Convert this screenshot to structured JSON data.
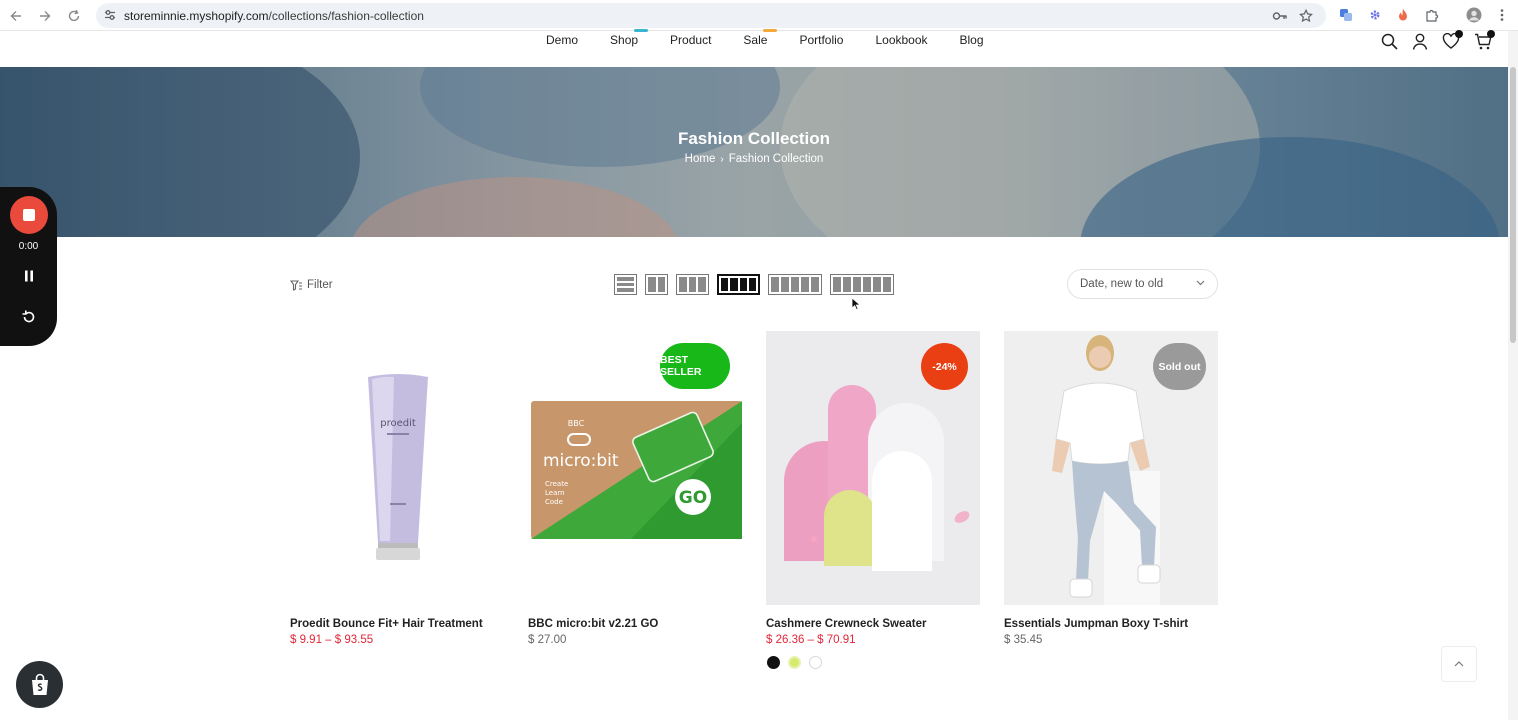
{
  "browser": {
    "url_host": "storeminnie.myshopify.com",
    "url_path": "/collections/fashion-collection"
  },
  "header": {
    "nav": [
      {
        "label": "Demo",
        "mark": ""
      },
      {
        "label": "Shop",
        "mark": "#39b6ce"
      },
      {
        "label": "Product",
        "mark": ""
      },
      {
        "label": "Sale",
        "mark": "#f3a93b"
      },
      {
        "label": "Portfolio",
        "mark": ""
      },
      {
        "label": "Lookbook",
        "mark": ""
      },
      {
        "label": "Blog",
        "mark": ""
      }
    ],
    "icons": [
      "search-icon",
      "account-icon",
      "wishlist-icon",
      "cart-icon"
    ]
  },
  "hero": {
    "title": "Fashion Collection",
    "breadcrumb": {
      "home": "Home",
      "separator": "›",
      "current": "Fashion Collection"
    }
  },
  "recorder": {
    "time": "0:00"
  },
  "toolbar": {
    "filter_label": "Filter",
    "layouts": [
      {
        "name": "list",
        "columns": 1,
        "active": false
      },
      {
        "name": "grid-2",
        "columns": 2,
        "active": false
      },
      {
        "name": "grid-3",
        "columns": 3,
        "active": false
      },
      {
        "name": "grid-4",
        "columns": 4,
        "active": true
      },
      {
        "name": "grid-5",
        "columns": 5,
        "active": false
      },
      {
        "name": "grid-6",
        "columns": 6,
        "active": false
      }
    ],
    "sort_value": "Date, new to old"
  },
  "products": [
    {
      "name": "Proedit Bounce Fit+ Hair Treatment",
      "price": "$ 9.91 – $ 93.55",
      "price_type": "sale",
      "badge": "",
      "badge_color": "",
      "tube_text": "proedit",
      "swatches": []
    },
    {
      "name": "BBC micro:bit v2.21 GO",
      "price": "$ 27.00",
      "price_type": "reg",
      "badge": "BEST SELLER",
      "badge_color": "#17b817",
      "box_brand": "BBC",
      "box_title": "micro:bit",
      "box_lines": [
        "Create",
        "Learn",
        "Code"
      ],
      "box_go": "GO",
      "swatches": []
    },
    {
      "name": "Cashmere Crewneck Sweater",
      "price": "$ 26.36 – $ 70.91",
      "price_type": "sale",
      "badge": "-24%",
      "badge_color": "#ea3f12",
      "swatches": [
        "#111111",
        "#d6ea6d",
        "#ffffff"
      ]
    },
    {
      "name": "Essentials Jumpman Boxy T-shirt",
      "price": "$ 35.45",
      "price_type": "reg",
      "badge": "Sold out",
      "badge_color": "#9a9a9a",
      "swatches": []
    }
  ],
  "colors": {
    "sale_price": "#e0273a",
    "recorder_stop": "#ea4a3b"
  }
}
